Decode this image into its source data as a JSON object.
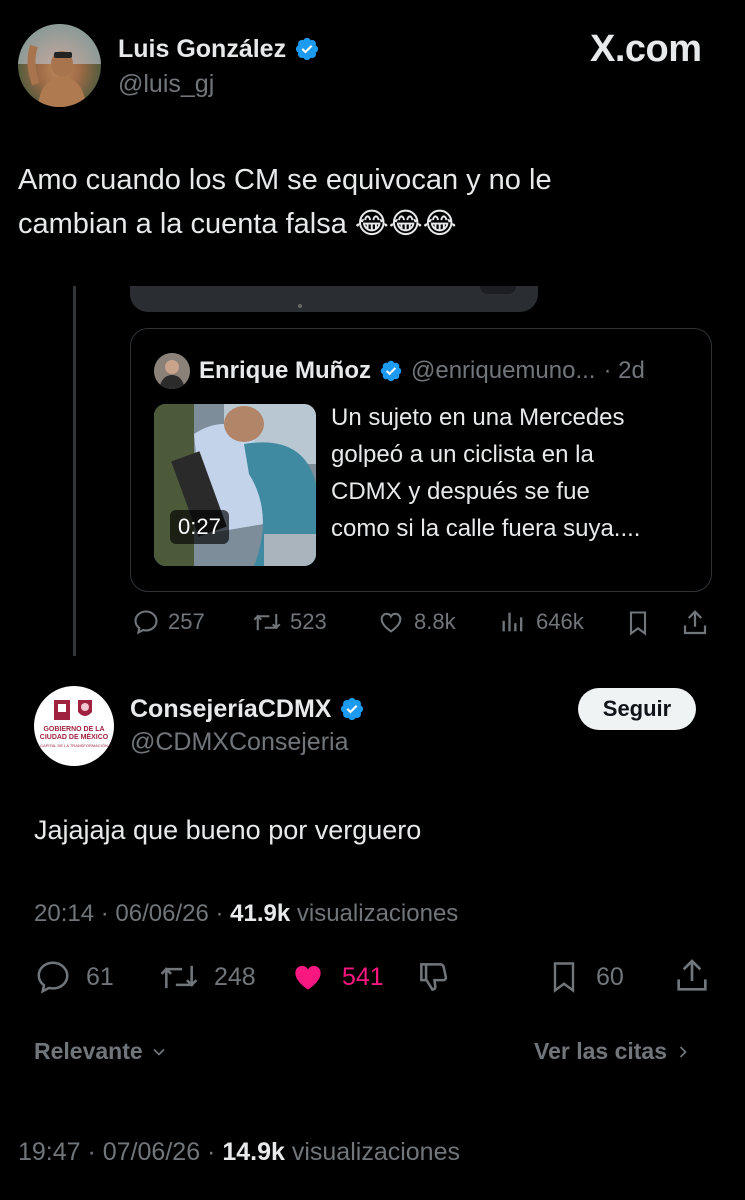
{
  "main_tweet": {
    "author_name": "Luis González",
    "handle": "@luis_gj",
    "brand": "X.com",
    "text_line1": "Amo cuando los CM se equivocan y no le",
    "text_line2": "cambian a la cuenta falsa 😂😂😂",
    "timestamp": "19:47 · 07/06/26 ·",
    "views_count": "14.9k",
    "views_label": "visualizaciones"
  },
  "quoted_tweet": {
    "author_name": "Enrique Muñoz",
    "handle": "@enriquemuno...",
    "age": "· 2d",
    "video_duration": "0:27",
    "text": [
      "Un sujeto en una Mercedes",
      "golpeó a un ciclista en la",
      "CDMX y después se fue",
      "como si la calle fuera suya...."
    ],
    "stats": {
      "replies": "257",
      "retweets": "523",
      "likes": "8.8k",
      "views": "646k"
    }
  },
  "reply_tweet": {
    "author_name": "ConsejeríaCDMX",
    "handle": "@CDMXConsejeria",
    "follow_label": "Seguir",
    "logo_text": [
      "GOBIERNO DE LA",
      "CIUDAD DE MÉXICO",
      "CAPITAL DE LA TRANSFORMACIÓN"
    ],
    "text": "Jajajaja que bueno por verguero",
    "timestamp": "20:14 · 06/06/26 ·",
    "views_count": "41.9k",
    "views_label": "visualizaciones",
    "stats": {
      "replies": "61",
      "retweets": "248",
      "likes": "541",
      "bookmarks": "60"
    },
    "sort_label": "Relevante",
    "quotes_link": "Ver las citas"
  },
  "colors": {
    "background": "#000000",
    "text": "#e7e9ea",
    "muted": "#71767b",
    "verified": "#1d9bf0",
    "like": "#f91880"
  },
  "icons": [
    "verified-badge-icon",
    "reply-icon",
    "retweet-icon",
    "like-icon",
    "views-icon",
    "bookmark-icon",
    "share-icon",
    "dislike-icon",
    "chevron-down-icon",
    "chevron-right-icon"
  ]
}
